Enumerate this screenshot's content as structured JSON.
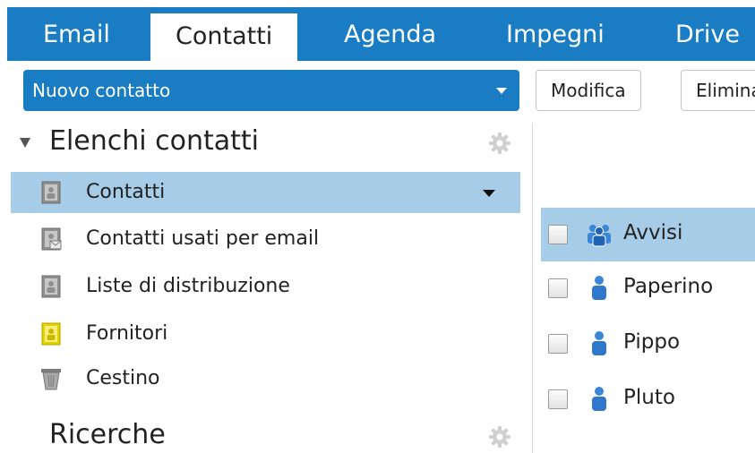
{
  "top_tabs": [
    {
      "label": "Email",
      "active": false
    },
    {
      "label": "Contatti",
      "active": true
    },
    {
      "label": "Agenda",
      "active": false
    },
    {
      "label": "Impegni",
      "active": false
    },
    {
      "label": "Drive",
      "active": false
    }
  ],
  "toolbar": {
    "new_contact_label": "Nuovo contatto",
    "edit_label": "Modifica",
    "delete_label": "Elimina"
  },
  "sidebar": {
    "address_books_title": "Elenchi contatti",
    "address_books": [
      {
        "label": "Contatti",
        "icon": "address-book-icon",
        "selected": true
      },
      {
        "label": "Contatti usati per email",
        "icon": "emailed-contacts-icon",
        "selected": false
      },
      {
        "label": "Liste di distribuzione",
        "icon": "distribution-list-icon",
        "selected": false
      },
      {
        "label": "Fornitori",
        "icon": "shared-address-book-icon",
        "selected": false
      },
      {
        "label": "Cestino",
        "icon": "trash-icon",
        "selected": false
      }
    ],
    "searches_title": "Ricerche"
  },
  "contacts": [
    {
      "name": "Avvisi",
      "type": "group",
      "selected": true
    },
    {
      "name": "Paperino",
      "type": "person",
      "selected": false
    },
    {
      "name": "Pippo",
      "type": "person",
      "selected": false
    },
    {
      "name": "Pluto",
      "type": "person",
      "selected": false
    }
  ],
  "colors": {
    "accent": "#1a7dc4",
    "selection": "#a7cce8"
  }
}
